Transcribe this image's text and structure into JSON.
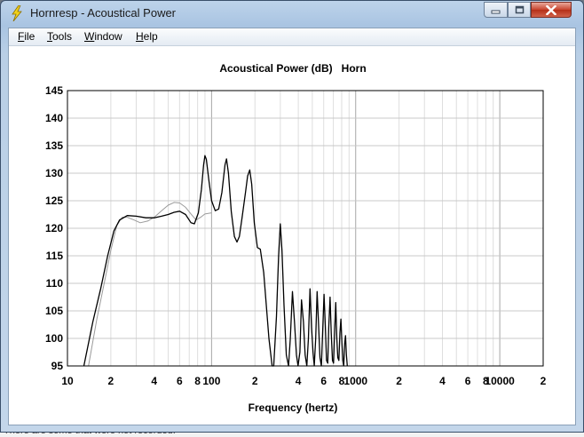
{
  "window": {
    "title": "Hornresp - Acoustical Power",
    "controls": {
      "minimize_icon": "minimize-icon",
      "maximize_icon": "maximize-icon",
      "close_icon": "close-icon"
    }
  },
  "menu": [
    {
      "key": "F",
      "rest": "ile"
    },
    {
      "key": "T",
      "rest": "ools"
    },
    {
      "key": "W",
      "rest": "indow"
    },
    {
      "key": "H",
      "rest": "elp"
    }
  ],
  "background_text": "There are some that were not recorded.",
  "chart_data": {
    "type": "line",
    "title": "Acoustical Power (dB)",
    "subtitle": "Horn",
    "xlabel": "Frequency (hertz)",
    "ylabel": "",
    "x_scale": "log",
    "xlim": [
      10,
      20000
    ],
    "ylim": [
      95,
      145
    ],
    "grid": true,
    "x_tick_labels": [
      {
        "x": 10,
        "label": "10"
      },
      {
        "x": 20,
        "label": "2"
      },
      {
        "x": 40,
        "label": "4"
      },
      {
        "x": 60,
        "label": "6"
      },
      {
        "x": 80,
        "label": "8"
      },
      {
        "x": 100,
        "label": "100"
      },
      {
        "x": 200,
        "label": "2"
      },
      {
        "x": 400,
        "label": "4"
      },
      {
        "x": 600,
        "label": "6"
      },
      {
        "x": 800,
        "label": "8"
      },
      {
        "x": 1000,
        "label": "1000"
      },
      {
        "x": 2000,
        "label": "2"
      },
      {
        "x": 4000,
        "label": "4"
      },
      {
        "x": 6000,
        "label": "6"
      },
      {
        "x": 8000,
        "label": "8"
      },
      {
        "x": 10000,
        "label": "10000"
      },
      {
        "x": 20000,
        "label": "2"
      }
    ],
    "y_tick_labels": [
      "95",
      "100",
      "105",
      "110",
      "115",
      "120",
      "125",
      "130",
      "135",
      "140",
      "145"
    ],
    "series": [
      {
        "color": "#000000",
        "points": [
          [
            13,
            95
          ],
          [
            15,
            103
          ],
          [
            17,
            109
          ],
          [
            19,
            115
          ],
          [
            21,
            119.5
          ],
          [
            23,
            121.5
          ],
          [
            26,
            122.3
          ],
          [
            30,
            122.2
          ],
          [
            35,
            121.9
          ],
          [
            40,
            121.9
          ],
          [
            45,
            122.2
          ],
          [
            50,
            122.5
          ],
          [
            55,
            122.9
          ],
          [
            60,
            123.1
          ],
          [
            66,
            122.5
          ],
          [
            72,
            121
          ],
          [
            76,
            120.8
          ],
          [
            81,
            122.8
          ],
          [
            85,
            127
          ],
          [
            88,
            131.5
          ],
          [
            90,
            133.2
          ],
          [
            92,
            132.5
          ],
          [
            96,
            128.5
          ],
          [
            100,
            125
          ],
          [
            106,
            123.2
          ],
          [
            112,
            123.5
          ],
          [
            118,
            126.5
          ],
          [
            124,
            131.5
          ],
          [
            127,
            132.6
          ],
          [
            131,
            130
          ],
          [
            137,
            123
          ],
          [
            144,
            118.5
          ],
          [
            150,
            117.5
          ],
          [
            156,
            118.5
          ],
          [
            163,
            122
          ],
          [
            172,
            126.5
          ],
          [
            178,
            129.5
          ],
          [
            184,
            130.6
          ],
          [
            190,
            128
          ],
          [
            198,
            121
          ],
          [
            208,
            116.5
          ],
          [
            218,
            116.2
          ],
          [
            230,
            112
          ],
          [
            250,
            100
          ],
          [
            263,
            95
          ],
          [
            270,
            95
          ],
          [
            282,
            104
          ],
          [
            292,
            115
          ],
          [
            300,
            120.8
          ],
          [
            308,
            116
          ],
          [
            318,
            106
          ],
          [
            330,
            97
          ],
          [
            342,
            95
          ],
          [
            352,
            100
          ],
          [
            364,
            108.5
          ],
          [
            376,
            103
          ],
          [
            388,
            97
          ],
          [
            398,
            95
          ],
          [
            410,
            97.5
          ],
          [
            421,
            107
          ],
          [
            434,
            103
          ],
          [
            446,
            97
          ],
          [
            458,
            95
          ],
          [
            470,
            100
          ],
          [
            482,
            109
          ],
          [
            494,
            102
          ],
          [
            506,
            97.5
          ],
          [
            516,
            95
          ],
          [
            528,
            100
          ],
          [
            540,
            108.5
          ],
          [
            552,
            103
          ],
          [
            565,
            96.5
          ],
          [
            578,
            95
          ],
          [
            590,
            101
          ],
          [
            603,
            108
          ],
          [
            616,
            102
          ],
          [
            628,
            96
          ],
          [
            640,
            95.5
          ],
          [
            650,
            102
          ],
          [
            664,
            107.5
          ],
          [
            677,
            101
          ],
          [
            690,
            96
          ],
          [
            702,
            95.5
          ],
          [
            715,
            101.5
          ],
          [
            727,
            106.5
          ],
          [
            740,
            100
          ],
          [
            752,
            96.5
          ],
          [
            764,
            96
          ],
          [
            778,
            101
          ],
          [
            790,
            103.5
          ],
          [
            803,
            99
          ],
          [
            815,
            96
          ],
          [
            826,
            95
          ],
          [
            838,
            99
          ],
          [
            850,
            100.5
          ],
          [
            862,
            97
          ],
          [
            874,
            95
          ]
        ]
      },
      {
        "color": "#9a9a9a",
        "points": [
          [
            14,
            95
          ],
          [
            16,
            103.5
          ],
          [
            18,
            110
          ],
          [
            20,
            116
          ],
          [
            22,
            120.5
          ],
          [
            24,
            122
          ],
          [
            26,
            122
          ],
          [
            29,
            121.5
          ],
          [
            32,
            121
          ],
          [
            36,
            121.3
          ],
          [
            40,
            122
          ],
          [
            45,
            123.2
          ],
          [
            50,
            124.2
          ],
          [
            55,
            124.7
          ],
          [
            60,
            124.6
          ],
          [
            66,
            123.8
          ],
          [
            72,
            122.6
          ],
          [
            78,
            121.5
          ],
          [
            84,
            122
          ],
          [
            90,
            122.6
          ],
          [
            100,
            122.8
          ]
        ]
      }
    ]
  }
}
